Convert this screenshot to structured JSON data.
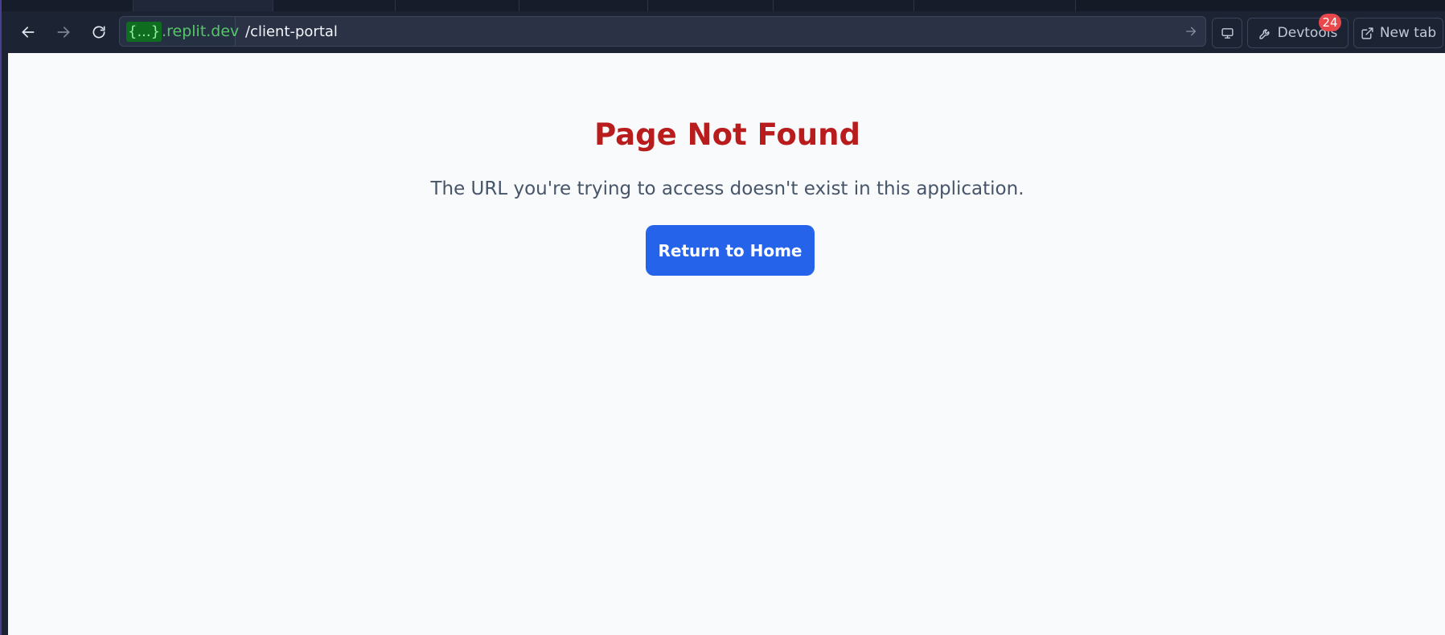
{
  "browser": {
    "url_host_masked": "{...}",
    "url_host_domain": ".replit.dev",
    "url_path": "/client-portal",
    "devtools_label": "Devtools",
    "devtools_badge": "24",
    "new_tab_label": "New tab",
    "icons": {
      "back": "arrow-left-icon",
      "forward": "arrow-right-icon",
      "reload": "reload-icon",
      "go": "go-arrow-icon",
      "screen": "monitor-icon",
      "devtools": "wrench-icon",
      "new_tab": "external-link-icon"
    },
    "colors": {
      "chrome_bg": "#1c2333",
      "host_text": "#58c56b",
      "badge": "#e8484c"
    }
  },
  "page": {
    "title": "Page Not Found",
    "description": "The URL you're trying to access doesn't exist in this application.",
    "button_label": "Return to Home",
    "colors": {
      "title": "#b91c1c",
      "button_bg": "#2563eb",
      "background": "#f8fafc"
    }
  }
}
